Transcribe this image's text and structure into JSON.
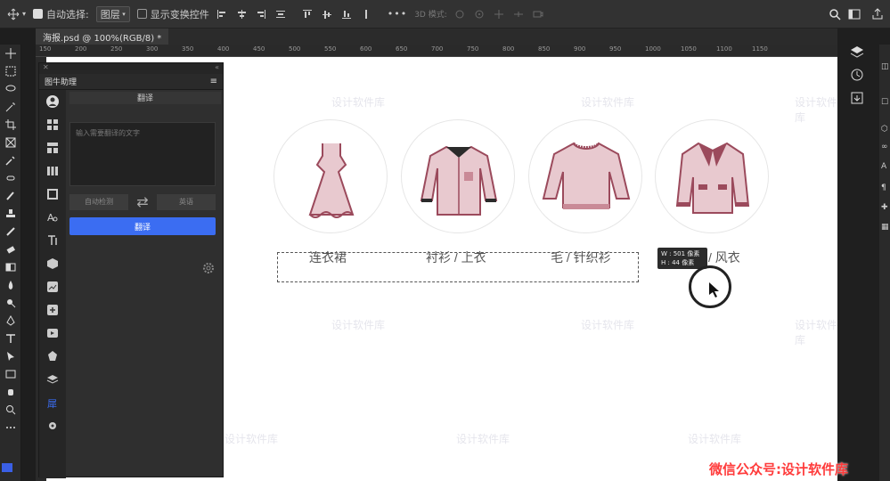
{
  "options_bar": {
    "auto_select_label": "自动选择:",
    "layer_select_value": "图层",
    "show_transform_label": "显示变换控件",
    "more_label": "•••",
    "mode_3d_label": "3D 模式:"
  },
  "document_tab": {
    "title": "海报.psd @ 100%(RGB/8) *"
  },
  "ruler": {
    "ticks": [
      "150",
      "200",
      "250",
      "300",
      "350",
      "400",
      "450",
      "500",
      "550",
      "600",
      "650",
      "700",
      "750",
      "800",
      "850",
      "900",
      "950",
      "1000",
      "1050",
      "1100",
      "1150"
    ]
  },
  "plugin_panel": {
    "title": "图牛助理",
    "section_title": "翻译",
    "input_placeholder": "输入需要翻译的文字",
    "source_lang": "自动检测",
    "target_lang": "英语",
    "swap_symbol": "⇄",
    "translate_button": "翻译"
  },
  "canvas": {
    "items": [
      {
        "label": "连衣裙"
      },
      {
        "label": "衬衫 / 上衣"
      },
      {
        "label": "毛 / 针织衫"
      },
      {
        "label": "/ 风衣"
      }
    ],
    "tooltip": {
      "w_line": "W : 501 像素",
      "h_line": "H :  44 像素"
    },
    "watermark_text": "设计软件库"
  },
  "footer_watermark": "微信公众号:设计软件库",
  "colors": {
    "accent": "#3b6df2",
    "swatch": "#3a5fe5",
    "garment_pink": "#e8c9cf",
    "garment_dark": "#9b4a5c"
  }
}
